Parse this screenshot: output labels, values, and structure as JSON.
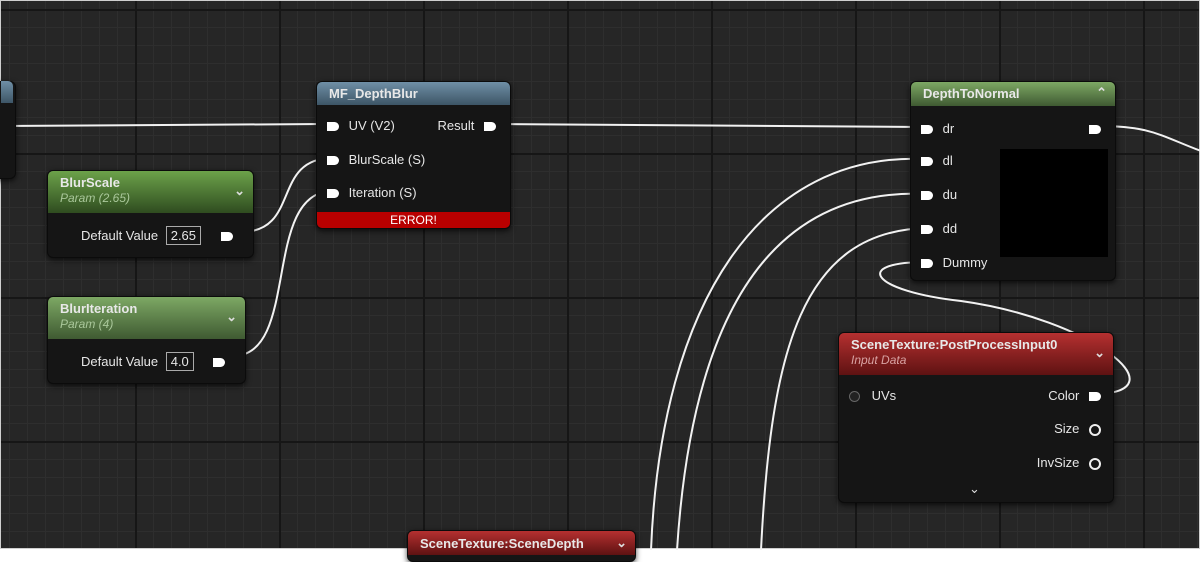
{
  "nodes": {
    "mf_depth_blur": {
      "title": "MF_DepthBlur",
      "inputs": [
        "UV (V2)",
        "BlurScale (S)",
        "Iteration (S)"
      ],
      "output": "Result",
      "error": "ERROR!"
    },
    "blur_scale": {
      "title": "BlurScale",
      "subtitle": "Param (2.65)",
      "default_label": "Default Value",
      "default_value": "2.65"
    },
    "blur_iteration": {
      "title": "BlurIteration",
      "subtitle": "Param (4)",
      "default_label": "Default Value",
      "default_value": "4.0"
    },
    "depth_to_normal": {
      "title": "DepthToNormal",
      "inputs": [
        "dr",
        "dl",
        "du",
        "dd",
        "Dummy"
      ]
    },
    "scene_texture_post": {
      "title": "SceneTexture:PostProcessInput0",
      "subtitle": "Input Data",
      "input": "UVs",
      "outputs": [
        "Color",
        "Size",
        "InvSize"
      ]
    },
    "scene_texture_depth": {
      "title": "SceneTexture:SceneDepth"
    }
  },
  "colors": {
    "material_function_header": "#3d5566",
    "parameter_header": "#2f4c20",
    "scene_texture_header": "#8a1f1f",
    "error_bar": "#b80000"
  },
  "icons": [
    "chevron-down-icon",
    "chevron-up-icon"
  ]
}
